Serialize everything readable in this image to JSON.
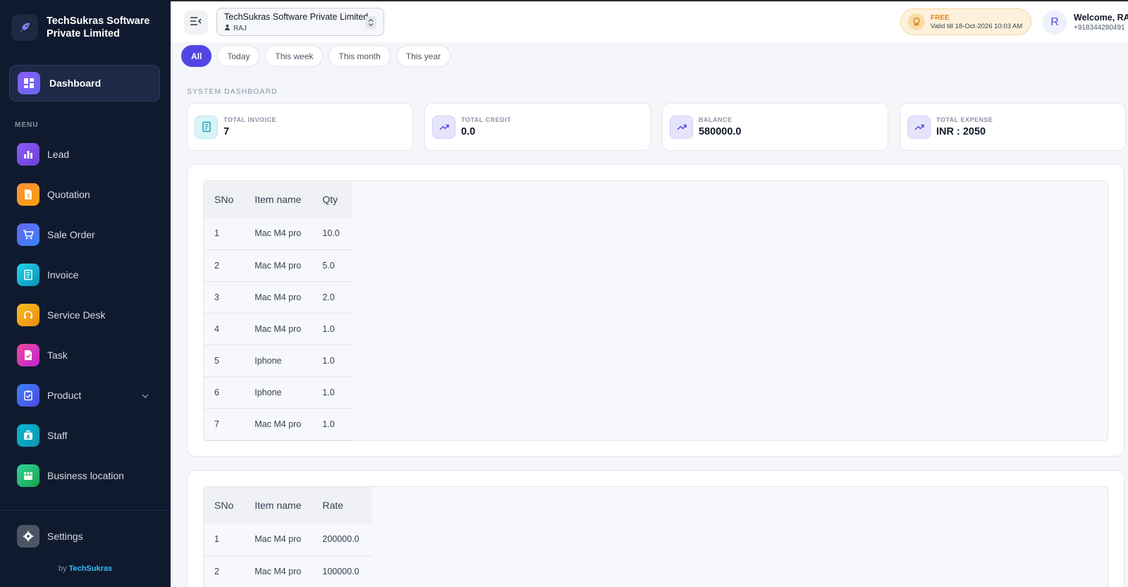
{
  "sidebar": {
    "company_name": "TechSukras Software Private Limited",
    "dashboard_label": "Dashboard",
    "menu_heading": "MENU",
    "items": [
      {
        "label": "Lead",
        "icon": "bar-chart-icon",
        "color": "#7c4ddb"
      },
      {
        "label": "Quotation",
        "icon": "quotation-icon",
        "color": "#f59e0b"
      },
      {
        "label": "Sale Order",
        "icon": "cart-icon",
        "color": "#4f6ef7"
      },
      {
        "label": "Invoice",
        "icon": "invoice-icon",
        "color": "#06a8d4"
      },
      {
        "label": "Service Desk",
        "icon": "headset-icon",
        "color": "#f29a0c"
      },
      {
        "label": "Task",
        "icon": "task-icon",
        "color": "#d946a8"
      },
      {
        "label": "Product",
        "icon": "product-icon",
        "color": "#3b6df0"
      },
      {
        "label": "Staff",
        "icon": "staff-icon",
        "color": "#0ea5b5"
      },
      {
        "label": "Business location",
        "icon": "store-icon",
        "color": "#22b455"
      }
    ],
    "settings_label": "Settings",
    "byline_prefix": "by",
    "byline_brand": "TechSukras"
  },
  "topbar": {
    "company_select": "TechSukras Software Private Limited",
    "user_name": "RAJ",
    "plan": "FREE",
    "validity": "Valid till 18-Oct-2026 10:03 AM",
    "avatar_initial": "R",
    "welcome": "Welcome, RAJ",
    "phone": "+918344280491"
  },
  "filters": [
    "All",
    "Today",
    "This week",
    "This month",
    "This year"
  ],
  "active_filter": "All",
  "dashboard": {
    "heading": "SYSTEM DASHBOARD",
    "stats": [
      {
        "label": "TOTAL INVOICE",
        "value": "7"
      },
      {
        "label": "TOTAL CREDIT",
        "value": "0.0"
      },
      {
        "label": "BALANCE",
        "value": "580000.0"
      },
      {
        "label": "TOTAL EXPENSE",
        "value": "INR : 2050"
      }
    ]
  },
  "qty_table": {
    "headers": [
      "SNo",
      "Item name",
      "Qty"
    ],
    "rows": [
      [
        "1",
        "Mac M4 pro",
        "10.0"
      ],
      [
        "2",
        "Mac M4 pro",
        "5.0"
      ],
      [
        "3",
        "Mac M4 pro",
        "2.0"
      ],
      [
        "4",
        "Mac M4 pro",
        "1.0"
      ],
      [
        "5",
        "Iphone",
        "1.0"
      ],
      [
        "6",
        "Iphone",
        "1.0"
      ],
      [
        "7",
        "Mac M4 pro",
        "1.0"
      ]
    ]
  },
  "rate_table": {
    "headers": [
      "SNo",
      "Item name",
      "Rate"
    ],
    "rows": [
      [
        "1",
        "Mac M4 pro",
        "200000.0"
      ],
      [
        "2",
        "Mac M4 pro",
        "100000.0"
      ]
    ]
  }
}
